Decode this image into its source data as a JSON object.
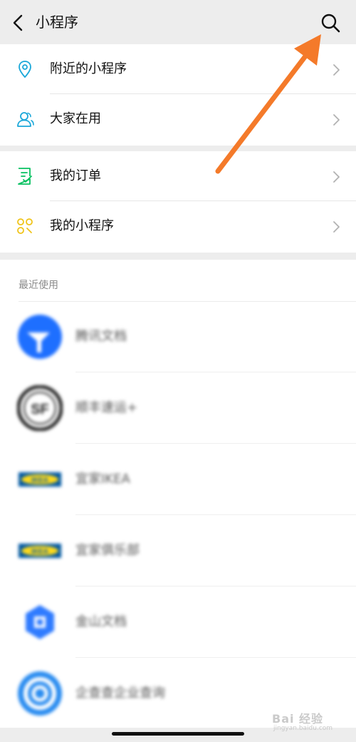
{
  "header": {
    "title": "小程序",
    "back_icon": "chevron-left-icon",
    "search_icon": "search-icon"
  },
  "groups": [
    {
      "items": [
        {
          "label": "附近的小程序",
          "icon": "location-pin-icon",
          "color": "#1aa7d9"
        },
        {
          "label": "大家在用",
          "icon": "users-icon",
          "color": "#1aa7d9"
        }
      ]
    },
    {
      "items": [
        {
          "label": "我的订单",
          "icon": "order-list-icon",
          "color": "#07c160"
        },
        {
          "label": "我的小程序",
          "icon": "mini-programs-icon",
          "color": "#f0c419"
        }
      ]
    }
  ],
  "recent": {
    "title": "最近使用",
    "apps": [
      {
        "name": "腾讯文档",
        "icon": "tencent-docs-logo"
      },
      {
        "name": "顺丰速运+",
        "icon": "sf-express-logo"
      },
      {
        "name": "宜家IKEA",
        "icon": "ikea-logo"
      },
      {
        "name": "宜家俱乐部",
        "icon": "ikea-club-logo"
      },
      {
        "name": "金山文档",
        "icon": "kingsoft-docs-logo"
      },
      {
        "name": "企查查企业查询",
        "icon": "qichacha-logo"
      }
    ]
  },
  "annotation": {
    "icon": "orange-arrow-icon",
    "color": "#f47a2a"
  },
  "watermark": {
    "text": "Bai 经验",
    "sub": "jingyan.baidu.com"
  },
  "colors": {
    "background": "#ededed",
    "card": "#ffffff",
    "chevron": "#b2b2b2"
  }
}
